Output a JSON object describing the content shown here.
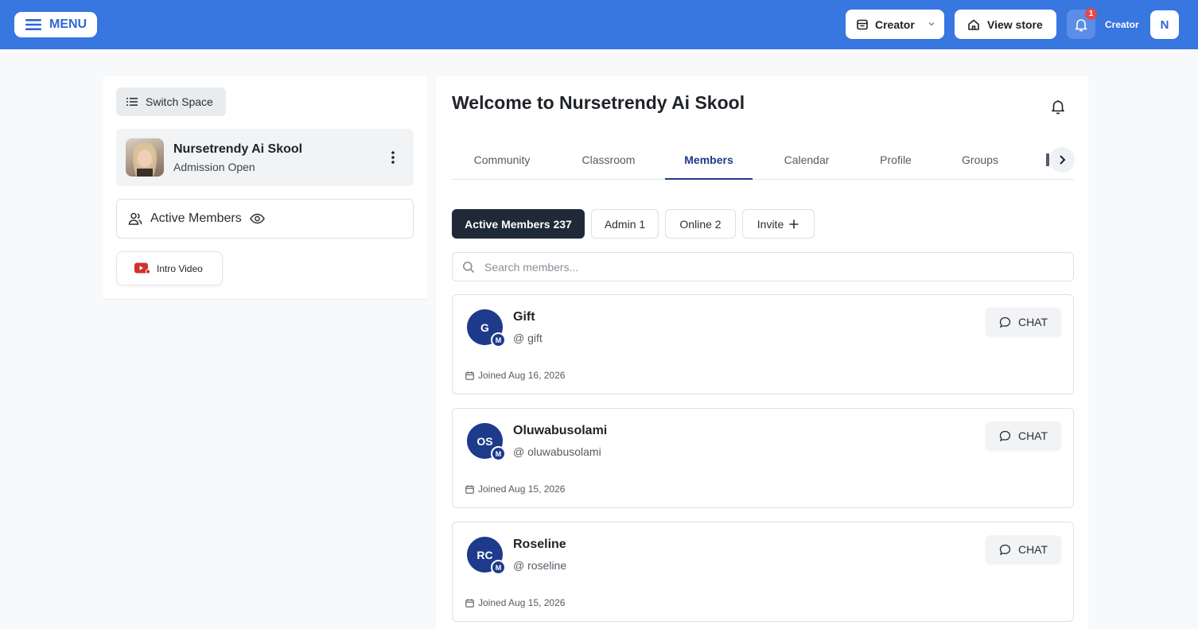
{
  "header": {
    "menu_label": "MENU",
    "creator_select": "Creator",
    "view_store": "View store",
    "notification_count": "1",
    "role_label": "Creator",
    "user_initial": "N",
    "accent_color": "#3876e0"
  },
  "sidebar": {
    "switch_space": "Switch Space",
    "space": {
      "name": "Nursetrendy Ai Skool",
      "status": "Admission Open"
    },
    "active_members": "Active Members",
    "intro_video": "Intro Video"
  },
  "main": {
    "title": "Welcome to Nursetrendy Ai Skool",
    "tabs": [
      {
        "label": "Community"
      },
      {
        "label": "Classroom"
      },
      {
        "label": "Members",
        "active": true
      },
      {
        "label": "Calendar"
      },
      {
        "label": "Profile"
      },
      {
        "label": "Groups"
      }
    ],
    "filters": [
      {
        "label": "Active Members 237",
        "active": true
      },
      {
        "label": "Admin 1"
      },
      {
        "label": "Online 2"
      },
      {
        "label": "Invite"
      }
    ],
    "search_placeholder": "Search members...",
    "chat_label": "CHAT",
    "members": [
      {
        "initials": "G",
        "badge": "M",
        "name": "Gift",
        "handle": "@ gift",
        "joined": "Joined Aug 16, 2026"
      },
      {
        "initials": "OS",
        "badge": "M",
        "name": "Oluwabusolami",
        "handle": "@ oluwabusolami",
        "joined": "Joined Aug 15, 2026"
      },
      {
        "initials": "RC",
        "badge": "M",
        "name": "Roseline",
        "handle": "@ roseline",
        "joined": "Joined Aug 15, 2026"
      }
    ]
  }
}
